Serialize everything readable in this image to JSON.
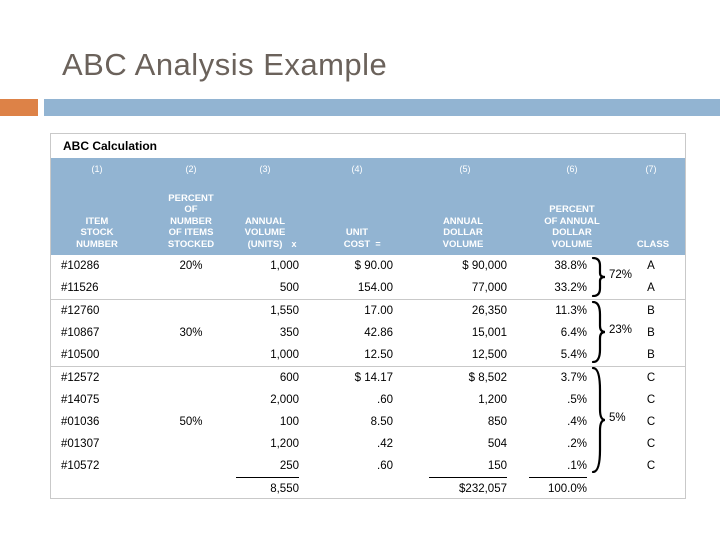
{
  "slide": {
    "title": "ABC Analysis Example",
    "accent_orange": "#dd8247",
    "accent_blue": "#92b4d2",
    "title_color": "#6b625b"
  },
  "table": {
    "caption": "ABC Calculation",
    "column_numbers": [
      "(1)",
      "(2)",
      "(3)",
      "(4)",
      "(5)",
      "(6)",
      "(7)"
    ],
    "headers": {
      "item": "ITEM\nSTOCK\nNUMBER",
      "item_l1": "ITEM",
      "item_l2": "STOCK",
      "item_l3": "NUMBER",
      "percent_items_l1": "PERCENT",
      "percent_items_l2": "OF",
      "percent_items_l3": "NUMBER",
      "percent_items_l4": "OF ITEMS",
      "percent_items_l5": "STOCKED",
      "volume_l1": "ANNUAL",
      "volume_l2": "VOLUME",
      "volume_l3": "(UNITS)",
      "unit_cost_l1": "UNIT",
      "unit_cost_l2": "COST",
      "annual_dollar_l1": "ANNUAL",
      "annual_dollar_l2": "DOLLAR",
      "annual_dollar_l3": "VOLUME",
      "percent_dollar_l1": "PERCENT",
      "percent_dollar_l2": "OF ANNUAL",
      "percent_dollar_l3": "DOLLAR",
      "percent_dollar_l4": "VOLUME",
      "class": "CLASS"
    },
    "operators": {
      "multiply": "x",
      "equals": "="
    },
    "rows": [
      {
        "item": "#10286",
        "percent_items": "20%",
        "volume": "1,000",
        "unit_cost": "$ 90.00",
        "dollar_volume": "$ 90,000",
        "percent_dollar": "38.8%",
        "class": "A"
      },
      {
        "item": "#11526",
        "percent_items": "",
        "volume": "500",
        "unit_cost": "154.00",
        "dollar_volume": "77,000",
        "percent_dollar": "33.2%",
        "class": "A"
      },
      {
        "item": "#12760",
        "percent_items": "",
        "volume": "1,550",
        "unit_cost": "17.00",
        "dollar_volume": "26,350",
        "percent_dollar": "11.3%",
        "class": "B"
      },
      {
        "item": "#10867",
        "percent_items": "30%",
        "volume": "350",
        "unit_cost": "42.86",
        "dollar_volume": "15,001",
        "percent_dollar": "6.4%",
        "class": "B"
      },
      {
        "item": "#10500",
        "percent_items": "",
        "volume": "1,000",
        "unit_cost": "12.50",
        "dollar_volume": "12,500",
        "percent_dollar": "5.4%",
        "class": "B"
      },
      {
        "item": "#12572",
        "percent_items": "",
        "volume": "600",
        "unit_cost": "$ 14.17",
        "dollar_volume": "$ 8,502",
        "percent_dollar": "3.7%",
        "class": "C"
      },
      {
        "item": "#14075",
        "percent_items": "",
        "volume": "2,000",
        "unit_cost": ".60",
        "dollar_volume": "1,200",
        "percent_dollar": ".5%",
        "class": "C"
      },
      {
        "item": "#01036",
        "percent_items": "50%",
        "volume": "100",
        "unit_cost": "8.50",
        "dollar_volume": "850",
        "percent_dollar": ".4%",
        "class": "C"
      },
      {
        "item": "#01307",
        "percent_items": "",
        "volume": "1,200",
        "unit_cost": ".42",
        "dollar_volume": "504",
        "percent_dollar": ".2%",
        "class": "C"
      },
      {
        "item": "#10572",
        "percent_items": "",
        "volume": "250",
        "unit_cost": ".60",
        "dollar_volume": "150",
        "percent_dollar": ".1%",
        "class": "C"
      }
    ],
    "totals": {
      "volume": "8,550",
      "dollar_volume": "$232,057",
      "percent_dollar": "100.0%"
    },
    "brace_groups": [
      {
        "label": "72%",
        "class": "A"
      },
      {
        "label": "23%",
        "class": "B"
      },
      {
        "label": "5%",
        "class": "C"
      }
    ]
  }
}
